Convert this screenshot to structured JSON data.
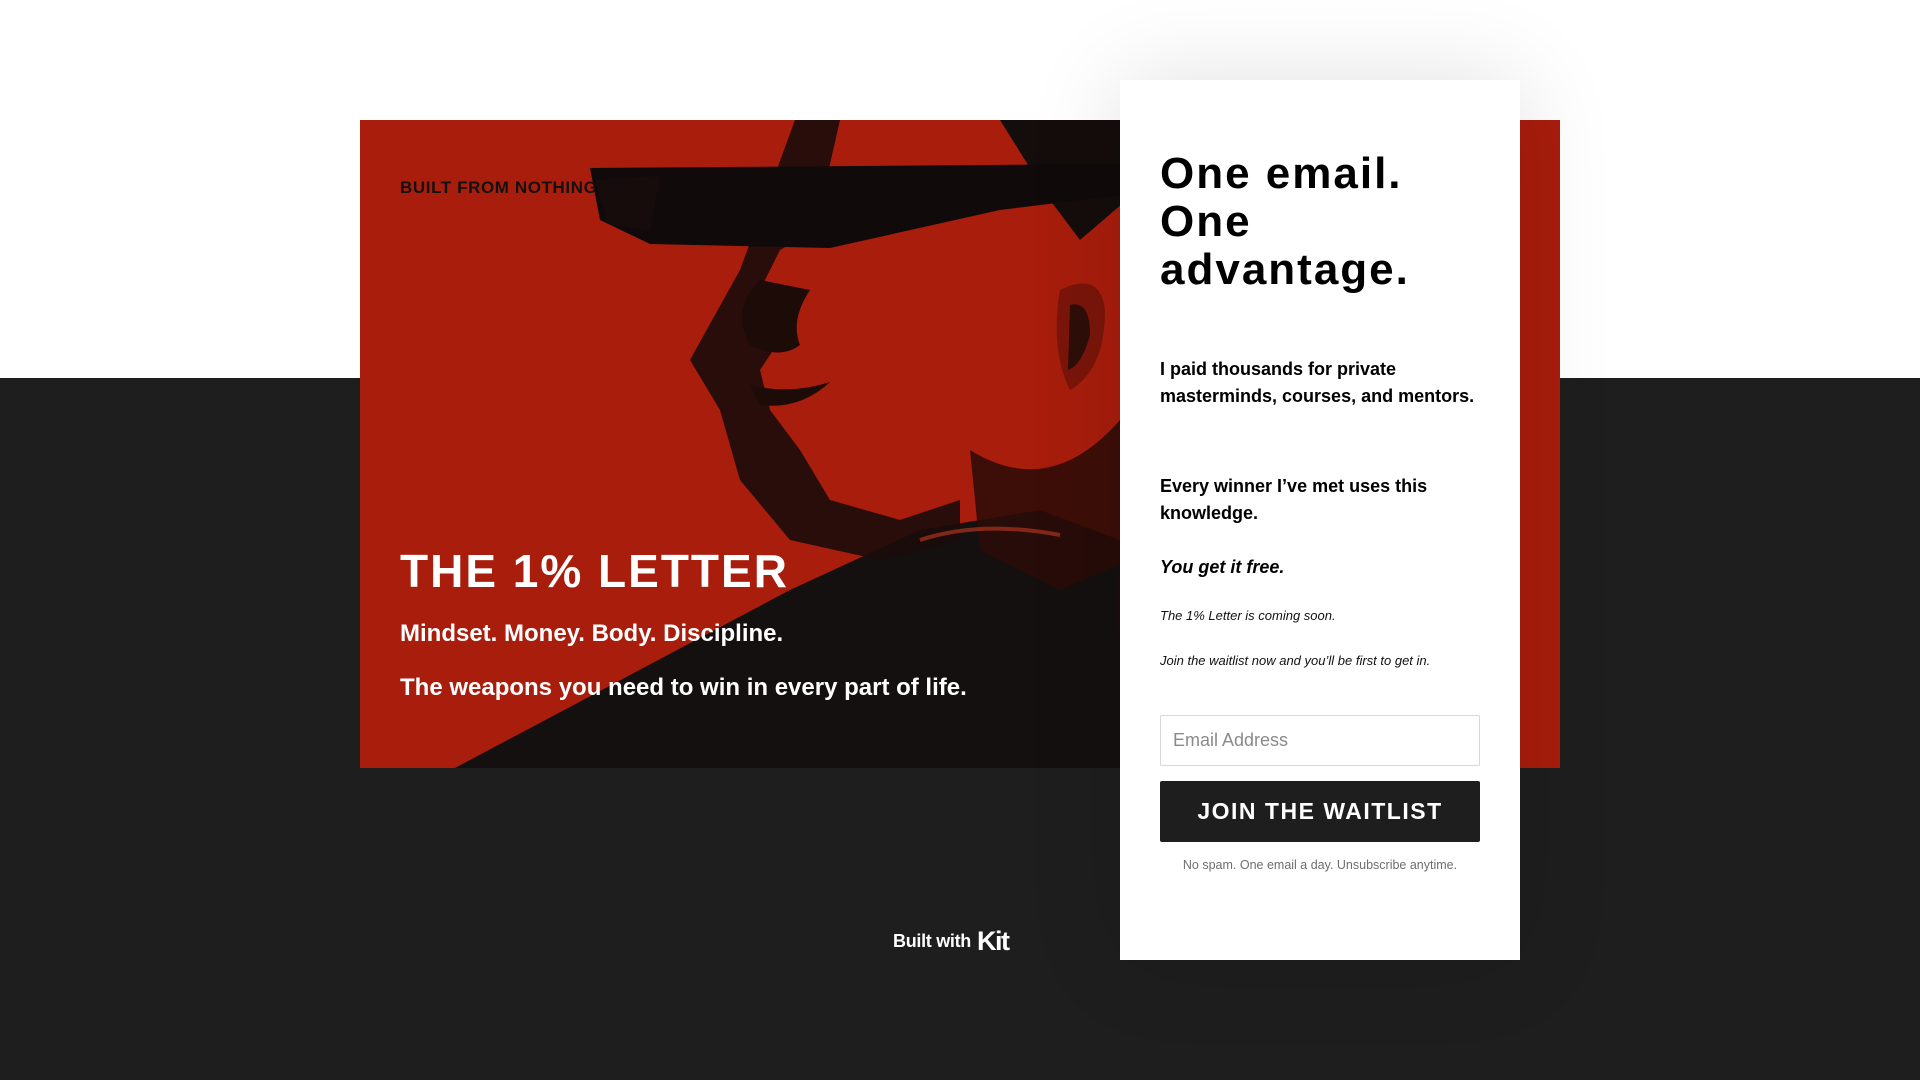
{
  "page": {
    "background_dark": "#1e1e1f",
    "background_light": "#ffffff",
    "accent_red": "#a81d0c"
  },
  "hero": {
    "brand": "BUILT FROM NOTHING",
    "title": "THE 1% LETTER",
    "subtitle": "Mindset. Money. Body. Discipline.",
    "tagline": "The weapons you need to win in every part of life.",
    "image": "man-with-blindfold-illustration"
  },
  "card": {
    "title": "One email. One advantage.",
    "paragraph_1": "I paid thousands for private masterminds, courses, and mentors.",
    "paragraph_2": "Every winner I’ve met uses this knowledge.",
    "paragraph_3": "You get it free.",
    "note_1": "The 1% Letter is coming soon.",
    "note_2": "Join the waitlist now and you’ll be first to get in.",
    "email": {
      "placeholder": "Email Address",
      "value": ""
    },
    "submit_label": "JOIN THE WAITLIST",
    "fineprint": "No spam. One email a day. Unsubscribe anytime."
  },
  "footer": {
    "built_with_label": "Built with",
    "logo_text": "Kit"
  }
}
